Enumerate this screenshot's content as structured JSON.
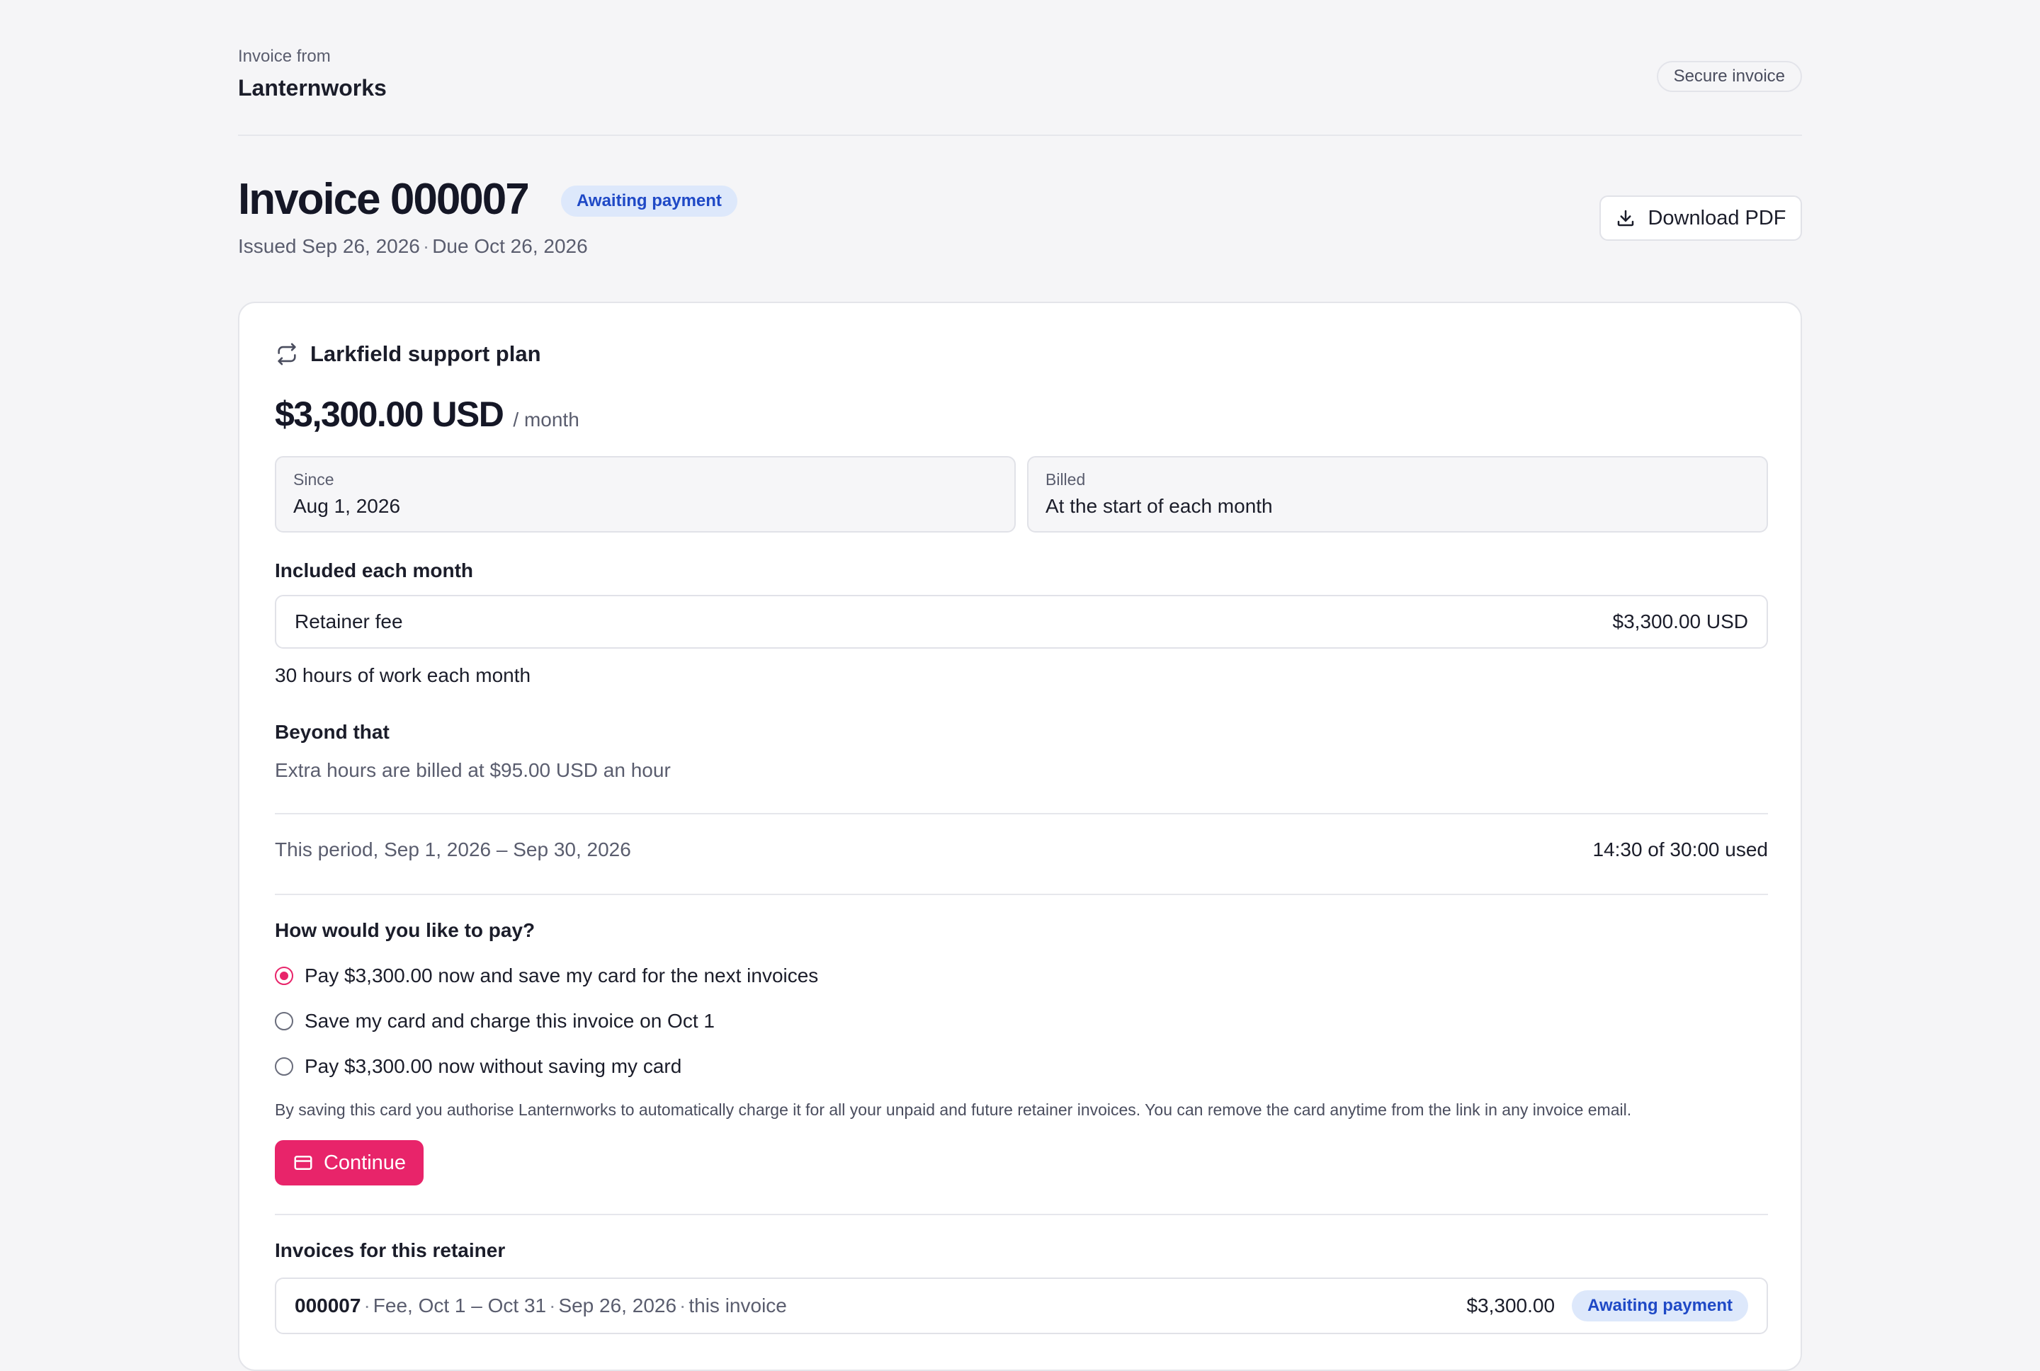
{
  "header": {
    "from_label": "Invoice from",
    "company": "Lanternworks",
    "secure_badge": "Secure invoice"
  },
  "invoice": {
    "title": "Invoice 000007",
    "status": "Awaiting payment",
    "issued": "Issued Sep 26, 2026",
    "due": "Due Oct 26, 2026",
    "download_label": "Download PDF"
  },
  "plan": {
    "icon": "repeat-icon",
    "name": "Larkfield support plan",
    "price": "$3,300.00 USD",
    "period": "/ month",
    "since_label": "Since",
    "since_value": "Aug 1, 2026",
    "billed_label": "Billed",
    "billed_value": "At the start of each month",
    "included_heading": "Included each month",
    "fee_name": "Retainer fee",
    "fee_amount": "$3,300.00 USD",
    "hours_included": "30 hours of work each month",
    "beyond_heading": "Beyond that",
    "beyond_text": "Extra hours are billed at $95.00 USD an hour",
    "period_label": "This period, Sep 1, 2026 – Sep 30, 2026",
    "period_used": "14:30 of 30:00 used"
  },
  "payment": {
    "heading": "How would you like to pay?",
    "options": [
      {
        "label": "Pay $3,300.00 now and save my card for the next invoices",
        "checked": true
      },
      {
        "label": "Save my card and charge this invoice on Oct 1",
        "checked": false
      },
      {
        "label": "Pay $3,300.00 now without saving my card",
        "checked": false
      }
    ],
    "consent": "By saving this card you authorise Lanternworks to automatically charge it for all your unpaid and future retainer invoices. You can remove the card anytime from the link in any invoice email.",
    "continue_label": "Continue",
    "accent": "#e8246a"
  },
  "retainer_invoices": {
    "heading": "Invoices for this retainer",
    "rows": [
      {
        "number": "000007",
        "description": "Fee, Oct 1 – Oct 31",
        "date": "Sep 26, 2026",
        "note": "this invoice",
        "amount": "$3,300.00",
        "status": "Awaiting payment"
      }
    ]
  },
  "colors": {
    "status_bg": "#dde8fb",
    "status_text": "#1f49c6"
  }
}
